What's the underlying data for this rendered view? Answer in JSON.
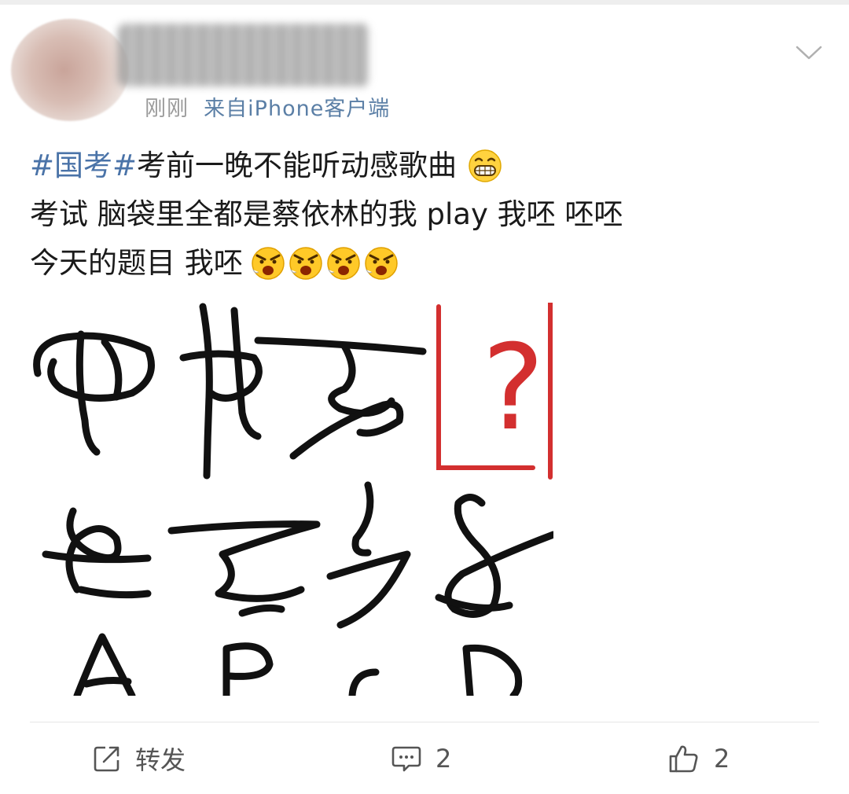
{
  "header": {
    "time": "刚刚",
    "source": "来自iPhone客户端",
    "avatar_icon": "blurred-avatar",
    "name_icon": "blurred-username",
    "menu_icon": "chevron-down-icon"
  },
  "post": {
    "line1": {
      "hashtag": "#国考#",
      "text": "考前一晚不能听动感歌曲",
      "emoji": "grinning-face-emoji"
    },
    "line2": "考试 脑袋里全都是蔡依林的我 play 我呸 呸呸",
    "line3": {
      "text": "今天的题目 我呸",
      "emoji": "angry-face-emoji",
      "emoji_count": 4
    }
  },
  "image": {
    "question_mark": "?",
    "options": [
      "A",
      "B",
      "C",
      "D"
    ]
  },
  "actions": {
    "repost_label": "转发",
    "comment_count": "2",
    "like_count": "2"
  },
  "colors": {
    "hashtag": "#4a73a8",
    "source_link": "#5b7fa6",
    "question_box": "#d32f2f",
    "text": "#1a1a1a"
  }
}
